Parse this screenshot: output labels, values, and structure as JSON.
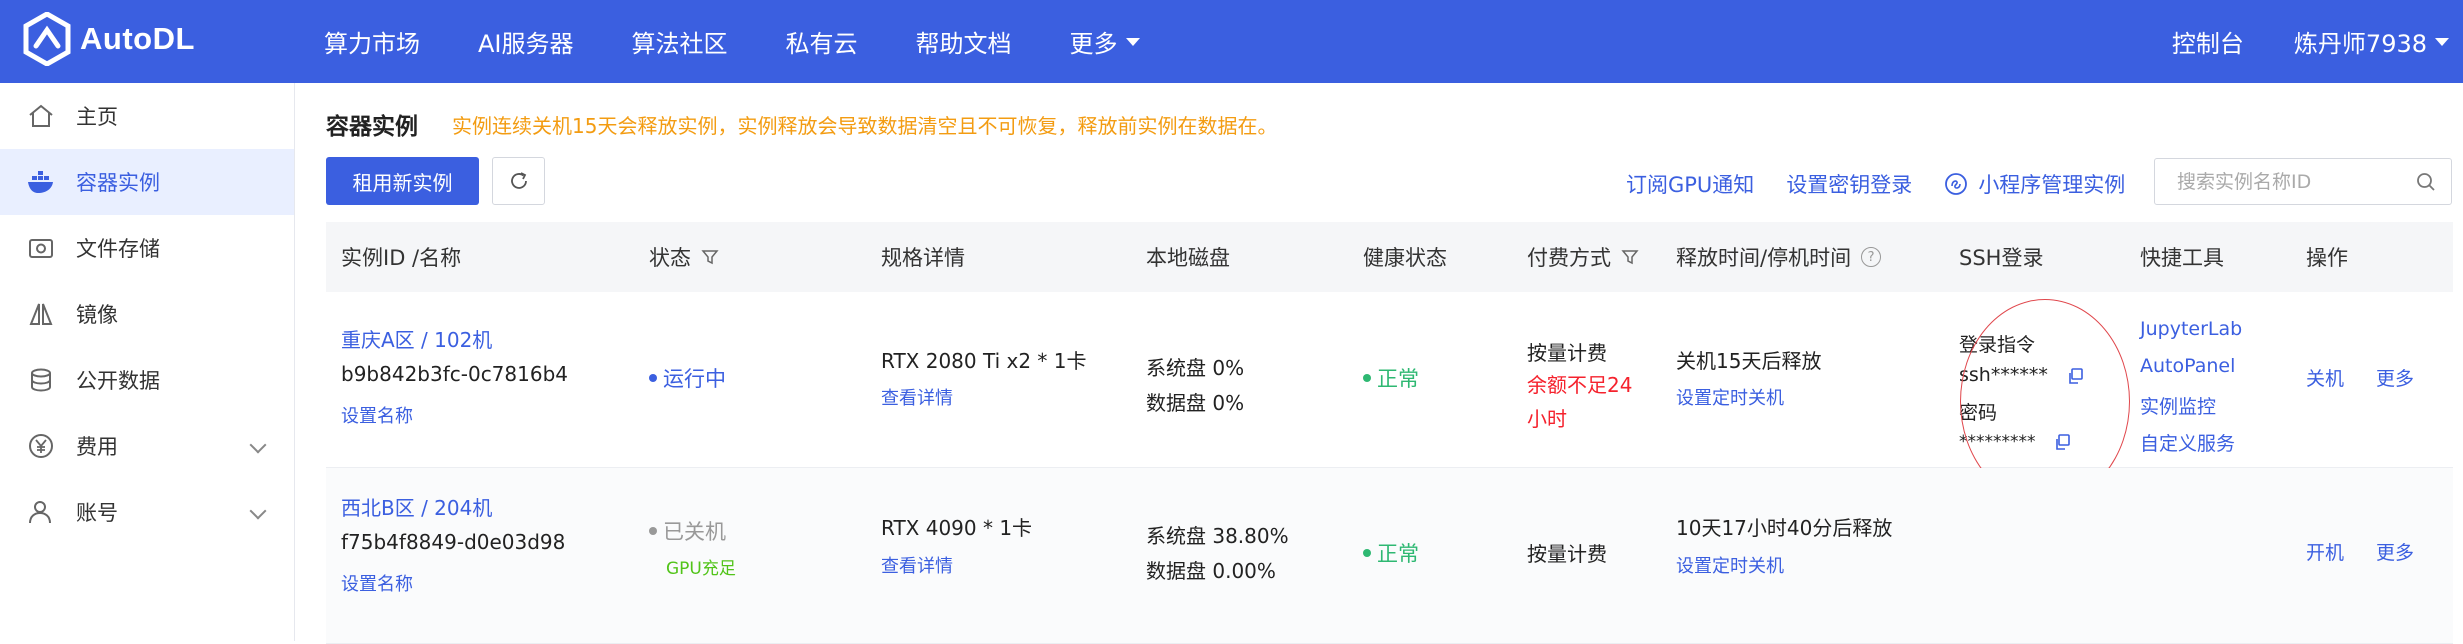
{
  "app": {
    "logo_text": "AutoDL",
    "nav": [
      "算力市场",
      "AI服务器",
      "算法社区",
      "私有云",
      "帮助文档"
    ],
    "nav_more": "更多",
    "console": "控制台",
    "user": "炼丹师7938"
  },
  "sidebar": {
    "items": [
      {
        "label": "主页",
        "icon": "home-icon"
      },
      {
        "label": "容器实例",
        "icon": "docker-icon"
      },
      {
        "label": "文件存储",
        "icon": "storage-icon"
      },
      {
        "label": "镜像",
        "icon": "mirror-icon"
      },
      {
        "label": "公开数据",
        "icon": "database-icon"
      },
      {
        "label": "费用",
        "icon": "yen-icon"
      },
      {
        "label": "账号",
        "icon": "user-icon"
      }
    ]
  },
  "page": {
    "title": "容器实例",
    "notice": "实例连续关机15天会释放实例，实例释放会导致数据清空且不可恢复，释放前实例在数据在。",
    "rent_button": "租用新实例",
    "links": [
      "订阅GPU通知",
      "设置密钥登录",
      "小程序管理实例"
    ],
    "search_placeholder": "搜索实例名称ID"
  },
  "table": {
    "headers": [
      "实例ID /名称",
      "状态",
      "规格详情",
      "本地磁盘",
      "健康状态",
      "付费方式",
      "释放时间/停机时间",
      "SSH登录",
      "快捷工具",
      "操作"
    ],
    "rows": [
      {
        "region": "重庆A区 / 102机",
        "id": "b9b842b3fc-0c7816b4",
        "set_name": "设置名称",
        "status": "运行中",
        "spec": "RTX 2080 Ti x2 * 1卡",
        "spec_link": "查看详情",
        "sys_disk": "系统盘 0%",
        "data_disk": "数据盘 0%",
        "health": "正常",
        "billing": "按量计费",
        "billing_warn": "余额不足24小时",
        "release": "关机15天后释放",
        "release_link": "设置定时关机",
        "ssh_cmd_label": "登录指令",
        "ssh_cmd": "ssh******",
        "ssh_pwd_label": "密码",
        "ssh_pwd": "*********",
        "tools": [
          "JupyterLab",
          "AutoPanel",
          "实例监控",
          "自定义服务"
        ],
        "action_main": "关机",
        "action_more": "更多"
      },
      {
        "region": "西北B区 / 204机",
        "id": "f75b4f8849-d0e03d98",
        "set_name": "设置名称",
        "status": "已关机",
        "gpu_status": "GPU充足",
        "spec": "RTX 4090 * 1卡",
        "spec_link": "查看详情",
        "sys_disk": "系统盘 38.80%",
        "data_disk": "数据盘 0.00%",
        "health": "正常",
        "billing": "按量计费",
        "release": "10天17小时40分后释放",
        "release_link": "设置定时关机",
        "action_main": "开机",
        "action_more": "更多"
      }
    ]
  },
  "colors": {
    "brand": "#3b5fe0",
    "warning": "#f39c12",
    "danger": "#f5222d",
    "success": "#2eb872"
  }
}
